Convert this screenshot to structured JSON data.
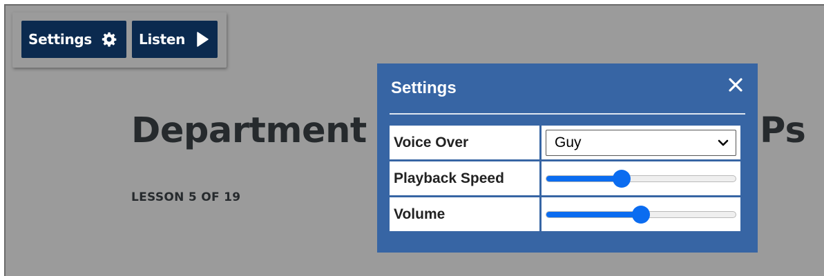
{
  "toolbar": {
    "settings_label": "Settings",
    "settings_icon": "gear-icon",
    "listen_label": "Listen",
    "listen_icon": "play-icon"
  },
  "page": {
    "heading_left": "Department",
    "heading_right": "Ps",
    "lesson_label": "LESSON 5 OF 19"
  },
  "dialog": {
    "title": "Settings",
    "close_icon": "close-icon",
    "rows": [
      {
        "label": "Voice Over",
        "value": "Guy"
      },
      {
        "label": "Playback Speed",
        "level": 0.4
      },
      {
        "label": "Volume",
        "level": 0.5
      }
    ]
  },
  "colors": {
    "overlay": "#9b9b9b",
    "button_bg": "#0b2a4f",
    "dialog_bg": "#3765a4",
    "slider_accent": "#0b6cf0"
  }
}
